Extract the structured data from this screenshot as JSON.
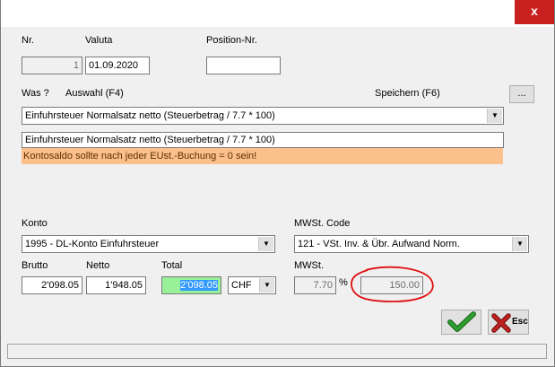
{
  "window": {
    "close_label": "x"
  },
  "labels": {
    "nr": "Nr.",
    "valuta": "Valuta",
    "position_nr": "Position-Nr.",
    "was": "Was ?",
    "auswahl": "Auswahl (F4)",
    "speichern": "Speichern (F6)",
    "konto": "Konto",
    "mwst_code": "MWSt. Code",
    "brutto": "Brutto",
    "netto": "Netto",
    "total": "Total",
    "mwst": "MWSt.",
    "percent": "%"
  },
  "fields": {
    "nr": "1",
    "valuta": "01.09.2020",
    "position_nr": "",
    "was_select": "Einfuhrsteuer Normalsatz netto (Steuerbetrag / 7.7 * 100)",
    "description": "Einfuhrsteuer Normalsatz netto (Steuerbetrag / 7.7 * 100)",
    "note": "Kontosaldo sollte nach jeder EUst.-Buchung = 0 sein!",
    "konto": "1995 - DL-Konto Einfuhrsteuer",
    "mwst_code": "121 - VSt. Inv. & Übr. Aufwand Norm.",
    "brutto": "2'098.05",
    "netto": "1'948.05",
    "total": "2'098.05",
    "currency": "CHF",
    "mwst_rate": "7.70",
    "mwst_amount": "150.00"
  },
  "buttons": {
    "browse": "...",
    "esc": "Esc"
  },
  "icons": {
    "confirm": "check-icon",
    "cancel": "x-esc-icon",
    "dropdown": "chevron-down-icon"
  },
  "colors": {
    "close_button": "#c8201f",
    "note_background": "#fcc08c",
    "total_field": "#98f098",
    "selection": "#3399ff",
    "confirm_check": "#2e9e2e",
    "cancel_x": "#c0201f",
    "annotation": "#e01010"
  }
}
